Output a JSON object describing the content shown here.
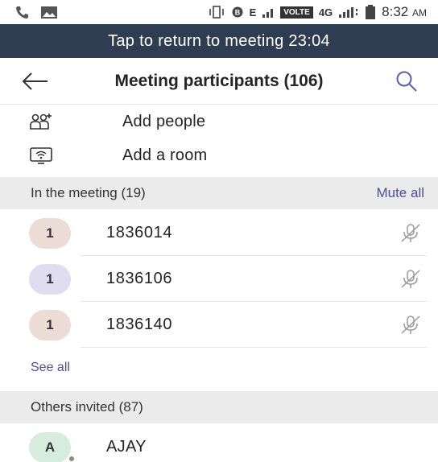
{
  "status_bar": {
    "network_e": "E",
    "volte": "VOLTE",
    "network_4g": "4G",
    "time": "8:32",
    "ampm": "AM"
  },
  "banner": {
    "text": "Tap to return to meeting 23:04"
  },
  "header": {
    "title": "Meeting participants (106)"
  },
  "actions": [
    {
      "label": "Add people",
      "icon": "add-people-icon"
    },
    {
      "label": "Add a room",
      "icon": "room-icon"
    }
  ],
  "in_meeting": {
    "label": "In the meeting (19)",
    "action": "Mute all",
    "participants": [
      {
        "initial": "1",
        "name": "1836014",
        "avatar_color": "#ecdcd6"
      },
      {
        "initial": "1",
        "name": "1836106",
        "avatar_color": "#e0ddf0"
      },
      {
        "initial": "1",
        "name": "1836140",
        "avatar_color": "#ecdcd6"
      }
    ],
    "see_all": "See all"
  },
  "others_invited": {
    "label": "Others invited (87)",
    "participants": [
      {
        "initial": "A",
        "name": "AJAY",
        "avatar_color": "#d6ecdc"
      }
    ]
  },
  "colors": {
    "banner": "#2e3d52",
    "accent": "#4b4f9e",
    "section_bg": "#ebebeb"
  }
}
